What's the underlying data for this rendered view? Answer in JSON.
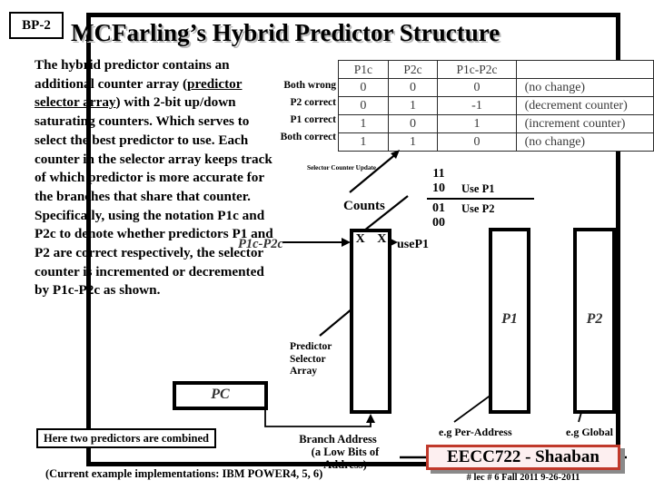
{
  "slide": {
    "tag": "BP-2",
    "title": "MCFarling’s Hybrid Predictor Structure",
    "footnote": "(Current example implementations:  IBM POWER4, 5, 6)"
  },
  "body": {
    "line1": "The hybrid predictor contains an additional counter array (",
    "underlined": "predictor selector array",
    "line2": ") with 2-bit up/down saturating counters. Which serves to select the best predictor to use. Each counter in the selector array keeps track of which predictor is more accurate for the branches that share that counter. Specifically, using the notation P1c and P2c to denote whether predictors P1 and P2 are correct respectively, the selector counter is incremented or decremented by P1c-P2c as shown."
  },
  "truth_table": {
    "headers": [
      "P1c",
      "P2c",
      "P1c-P2c",
      ""
    ],
    "row_labels": [
      "Both wrong",
      "P2 correct",
      "P1 correct",
      "Both correct"
    ],
    "rows": [
      [
        "0",
        "0",
        "0",
        "(no change)"
      ],
      [
        "0",
        "1",
        "-1",
        "(decrement counter)"
      ],
      [
        "1",
        "0",
        "1",
        "(increment counter)"
      ],
      [
        "1",
        "1",
        "0",
        "(no change)"
      ]
    ]
  },
  "diagram": {
    "selector_counter_update": "Selector Counter Update",
    "counts_label": "Counts",
    "states": [
      {
        "bits": "11",
        "use": ""
      },
      {
        "bits": "10",
        "use": "Use P1"
      },
      {
        "bits": "01",
        "use": "Use P2"
      },
      {
        "bits": "00",
        "use": ""
      }
    ],
    "p1c_minus_p2c": "P1c-P2c",
    "use_p1_signal": "useP1",
    "selector_array_cells": "X   X",
    "selector_array_label": "Predictor Selector Array",
    "p1_box": "P1",
    "p2_box": "P2",
    "pc_box": "PC",
    "branch_address_line1": "Branch Address",
    "branch_address_line2": "(a Low Bits of Address)",
    "eg_per_address": "e.g  Per-Address",
    "eg_global": "e.g  Global",
    "combine_note": "Here two predictors are combined"
  },
  "badge": {
    "course": "EECC722 - Shaaban",
    "sub": "#  lec # 6   Fall 2011   9-26-2011",
    "accent": "#c0392b"
  }
}
